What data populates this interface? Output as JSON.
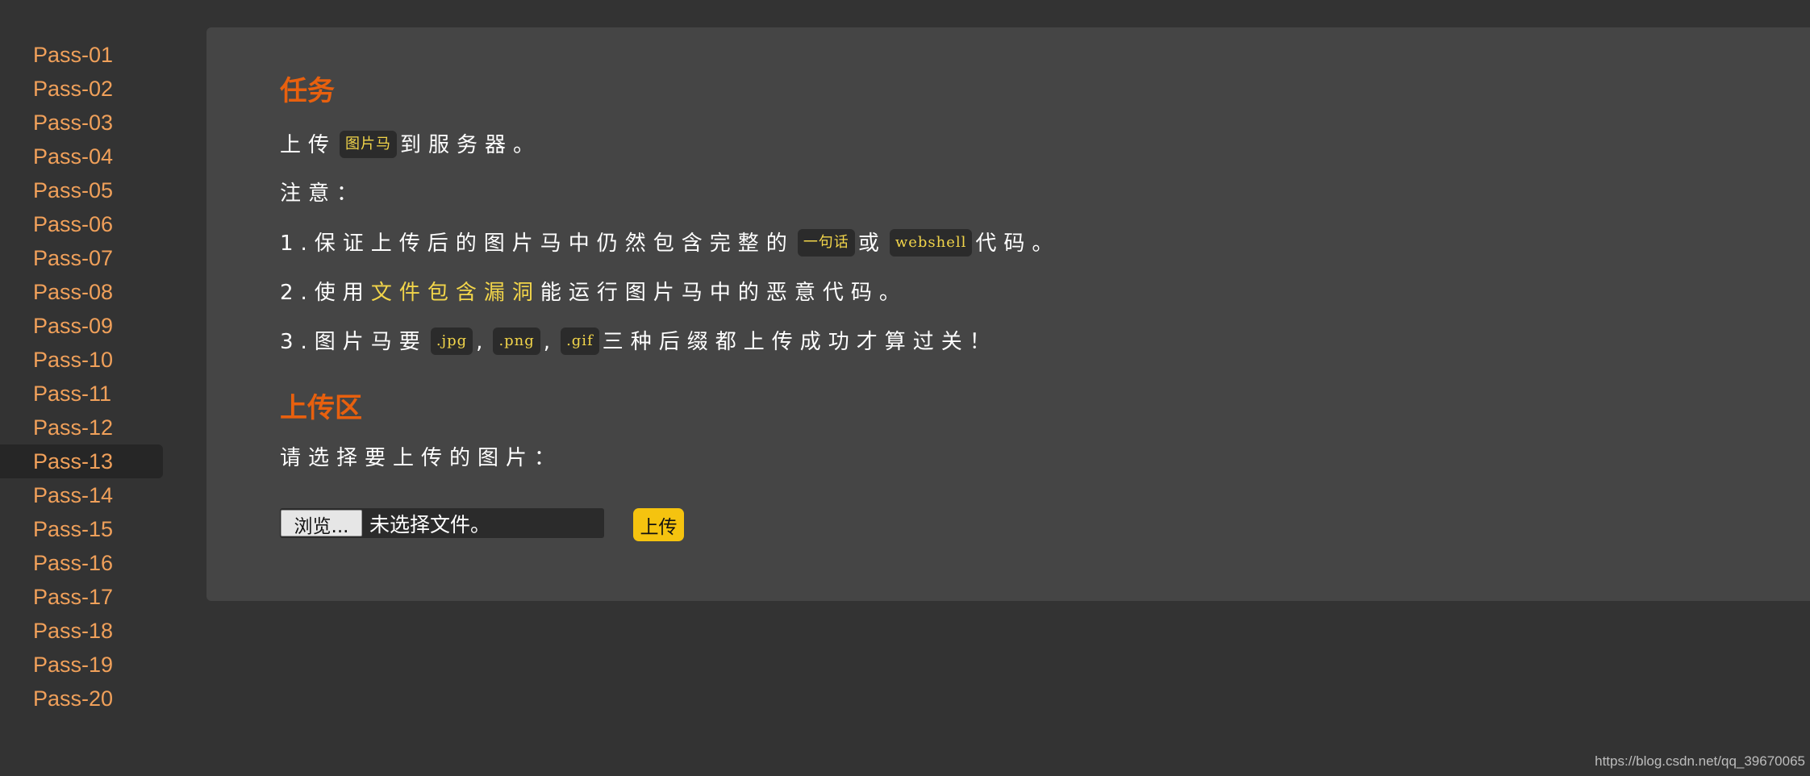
{
  "sidebar": {
    "items": [
      {
        "label": "Pass-01"
      },
      {
        "label": "Pass-02"
      },
      {
        "label": "Pass-03"
      },
      {
        "label": "Pass-04"
      },
      {
        "label": "Pass-05"
      },
      {
        "label": "Pass-06"
      },
      {
        "label": "Pass-07"
      },
      {
        "label": "Pass-08"
      },
      {
        "label": "Pass-09"
      },
      {
        "label": "Pass-10"
      },
      {
        "label": "Pass-11"
      },
      {
        "label": "Pass-12"
      },
      {
        "label": "Pass-13"
      },
      {
        "label": "Pass-14"
      },
      {
        "label": "Pass-15"
      },
      {
        "label": "Pass-16"
      },
      {
        "label": "Pass-17"
      },
      {
        "label": "Pass-18"
      },
      {
        "label": "Pass-19"
      },
      {
        "label": "Pass-20"
      }
    ],
    "active_label": "Pass-13"
  },
  "task": {
    "heading": "任务",
    "line1": {
      "pre": "上传",
      "code": "图片马",
      "post": "到服务器。"
    },
    "note_label": "注意：",
    "note1": {
      "pre": "1.保证上传后的图片马中仍然包含完整的",
      "code1": "一句话",
      "mid": "或",
      "code2": "webshell",
      "post": "代码。"
    },
    "note2": {
      "pre": "2.使用",
      "highlight": "文件包含漏洞",
      "post": "能运行图片马中的恶意代码。"
    },
    "note3": {
      "pre": "3.图片马要",
      "code1": ".jpg",
      "sep1": ",",
      "code2": ".png",
      "sep2": ",",
      "code3": ".gif",
      "post": "三种后缀都上传成功才算过关！"
    }
  },
  "upload": {
    "heading": "上传区",
    "prompt": "请选择要上传的图片：",
    "browse_label": "浏览...",
    "file_status": "未选择文件。",
    "submit_label": "上传"
  },
  "footer": {
    "watermark": "https://blog.csdn.net/qq_39670065"
  },
  "colors": {
    "background": "#333333",
    "panel": "#454545",
    "nav_link": "#f0a05a",
    "heading": "#e8600e",
    "code_text": "#f2d54a",
    "upload_button": "#f5c30f"
  }
}
